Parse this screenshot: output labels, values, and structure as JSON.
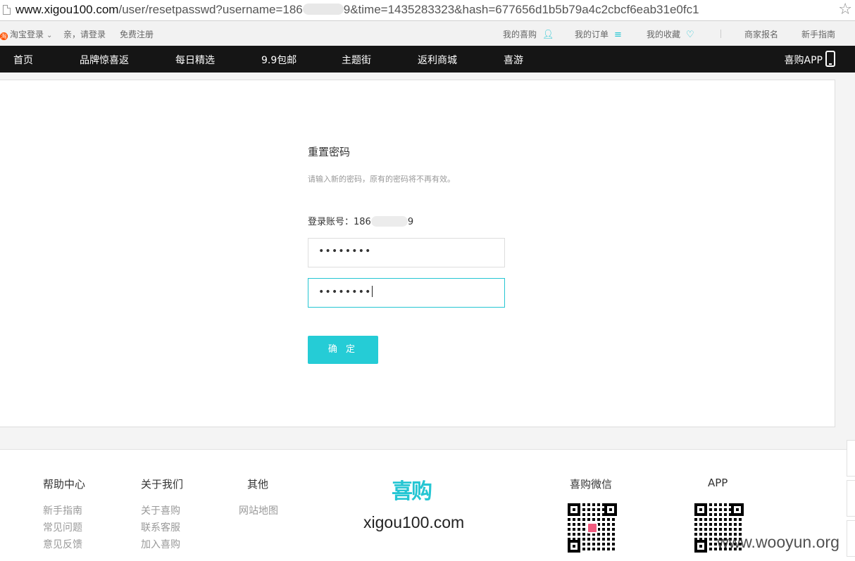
{
  "browser": {
    "url_host": "www.xigou100.com",
    "url_path_pre": "/user/resetpasswd?username=186",
    "url_path_post": "9&time=1435283323&hash=677656d1b5b79a4c2cbcf6eab31e0fc1",
    "star_glyph": "☆"
  },
  "topbar": {
    "taobao_login": "淘宝登录",
    "greeting": "亲，请登录",
    "register": "免费注册",
    "my_xigou": "我的喜购",
    "my_orders": "我的订单",
    "my_favorites": "我的收藏",
    "merchant_signup": "商家报名",
    "beginner_guide": "新手指南"
  },
  "nav": {
    "items": [
      "首页",
      "品牌惊喜返",
      "每日精选",
      "9.9包邮",
      "主题街",
      "返利商城",
      "喜游"
    ],
    "app_label": "喜购APP"
  },
  "form": {
    "title": "重置密码",
    "hint": "请输入新的密码，原有的密码将不再有效。",
    "account_label": "登录账号：",
    "account_pre": "186",
    "account_post": "9",
    "password1": "••••••••",
    "password2": "••••••••",
    "submit_label": "确 定"
  },
  "footer": {
    "help": {
      "heading": "帮助中心",
      "links": [
        "新手指南",
        "常见问题",
        "意见反馈"
      ]
    },
    "about": {
      "heading": "关于我们",
      "links": [
        "关于喜购",
        "联系客服",
        "加入喜购"
      ]
    },
    "other": {
      "heading": "其他",
      "links": [
        "网站地图"
      ]
    },
    "logo_text": "喜购",
    "domain": "xigou100.com",
    "wechat_heading": "喜购微信",
    "app_heading": "APP",
    "watermark": "www.wooyun.org"
  },
  "colors": {
    "accent": "#25c6d3",
    "nav_bg": "#151515",
    "qr_center": "#f05a7e"
  }
}
